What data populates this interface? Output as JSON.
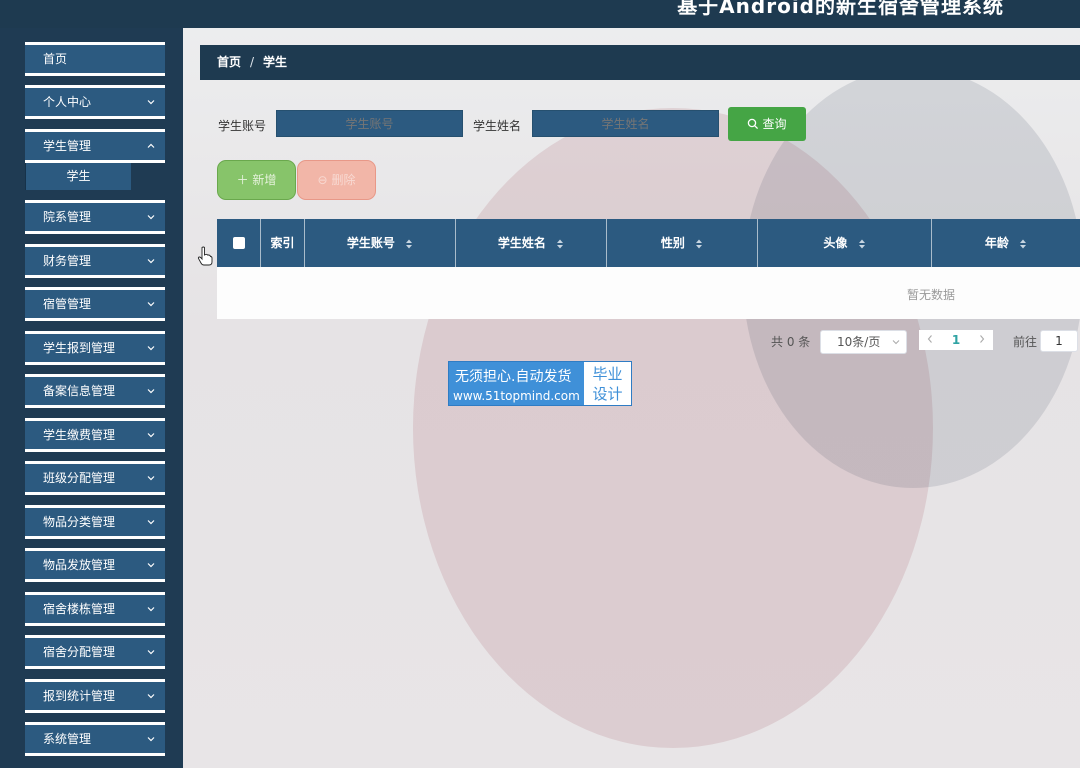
{
  "header": {
    "title": "基于Android的新生宿舍管理系统"
  },
  "sidebar": {
    "items": [
      {
        "label": "首页",
        "has_children": false
      },
      {
        "label": "个人中心",
        "has_children": true
      },
      {
        "label": "学生管理",
        "has_children": true,
        "expanded": true
      },
      {
        "label": "院系管理",
        "has_children": true
      },
      {
        "label": "财务管理",
        "has_children": true
      },
      {
        "label": "宿管管理",
        "has_children": true
      },
      {
        "label": "学生报到管理",
        "has_children": true
      },
      {
        "label": "备案信息管理",
        "has_children": true
      },
      {
        "label": "学生缴费管理",
        "has_children": true
      },
      {
        "label": "班级分配管理",
        "has_children": true
      },
      {
        "label": "物品分类管理",
        "has_children": true
      },
      {
        "label": "物品发放管理",
        "has_children": true
      },
      {
        "label": "宿舍楼栋管理",
        "has_children": true
      },
      {
        "label": "宿舍分配管理",
        "has_children": true
      },
      {
        "label": "报到统计管理",
        "has_children": true
      },
      {
        "label": "系统管理",
        "has_children": true
      }
    ],
    "sub_items": {
      "student": "学生"
    }
  },
  "breadcrumb": {
    "home": "首页",
    "separator": "/",
    "current": "学生"
  },
  "search": {
    "account_label": "学生账号",
    "account_placeholder": "学生账号",
    "name_label": "学生姓名",
    "name_placeholder": "学生姓名",
    "query_button": "查询"
  },
  "actions": {
    "add": "新增",
    "delete": "删除"
  },
  "table": {
    "columns": [
      "索引",
      "学生账号",
      "学生姓名",
      "性别",
      "头像",
      "年龄"
    ],
    "empty_text": "暂无数据"
  },
  "pagination": {
    "total": "共 0 条",
    "page_size": "10条/页",
    "current_page": "1",
    "goto_label": "前往",
    "goto_value": "1"
  },
  "watermark": {
    "line1": "无须担心.自动发货",
    "line2": "www.51topmind.com",
    "badge_line1": "毕业",
    "badge_line2": "设计"
  },
  "colors": {
    "header_bg": "#1e3a50",
    "primary": "#2c5a80",
    "query_green": "#45a545",
    "add_green": "#87c46a",
    "delete_red": "#f2b6a8",
    "pager_active": "#2fa3a3"
  }
}
